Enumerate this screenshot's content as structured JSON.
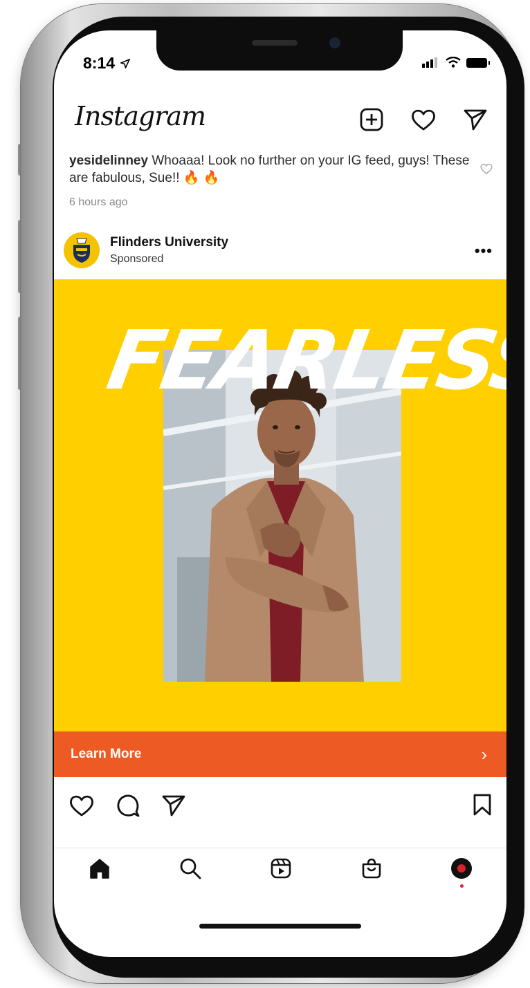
{
  "status_bar": {
    "time": "8:14"
  },
  "header": {
    "app_name": "Instagram"
  },
  "comment": {
    "username": "yesidelinney",
    "text": " Whoaaa! Look no further on your IG feed, guys! These are fabulous, Sue!! 🔥 🔥",
    "time_ago": "6 hours ago"
  },
  "post": {
    "account_name": "Flinders University",
    "label": "Sponsored",
    "more": "•••",
    "headline": "FEARLESS",
    "cta_label": "Learn More",
    "cta_arrow": "›"
  },
  "colors": {
    "ad_background": "#ffcf00",
    "cta_background": "#ee5a24",
    "notification_dot": "#e0243b"
  },
  "icons": {
    "top": [
      "add-post-icon",
      "heart-icon",
      "send-icon"
    ],
    "actions": [
      "like-icon",
      "comment-icon",
      "share-icon",
      "bookmark-icon"
    ],
    "tabs": [
      "home-icon",
      "search-icon",
      "reels-icon",
      "shop-icon",
      "profile-avatar"
    ]
  }
}
